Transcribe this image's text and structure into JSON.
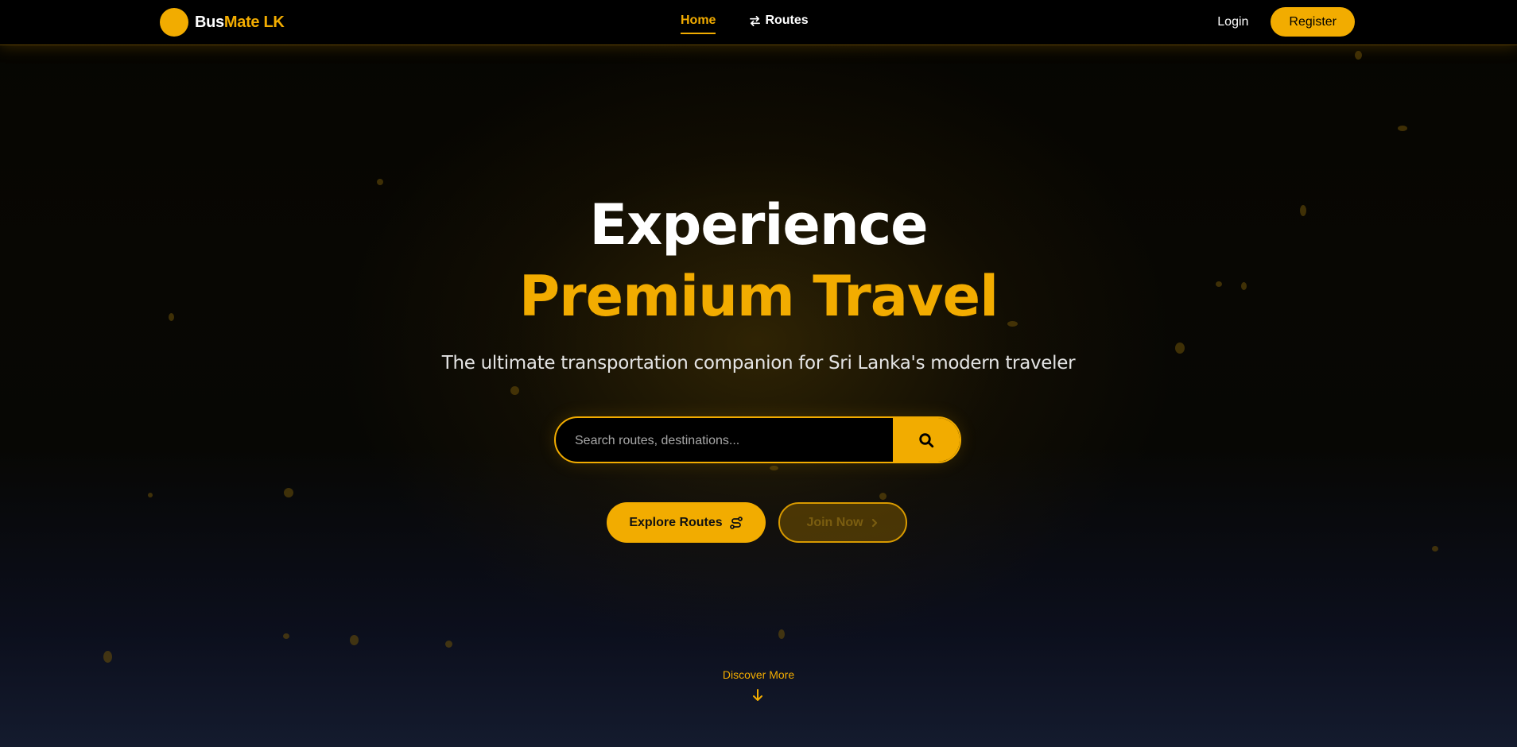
{
  "navbar": {
    "brand_part1": "Bus",
    "brand_part2": "Mate LK",
    "home_label": "Home",
    "routes_label": "Routes",
    "login_label": "Login",
    "register_label": "Register"
  },
  "hero": {
    "title_line1": "Experience",
    "title_line2": "Premium Travel",
    "subtitle": "The ultimate transportation companion for Sri Lanka's modern traveler"
  },
  "search": {
    "placeholder": "Search routes, destinations...",
    "value": "",
    "button_icon": "search-icon"
  },
  "buttons": {
    "explore_label": "Explore Routes",
    "explore_icon": "route-icon",
    "join_label": "Join Now",
    "join_icon": "chevron-right-icon"
  },
  "discover": {
    "label": "Discover More",
    "icon": "arrow-down-icon"
  },
  "colors": {
    "accent": "#f2ac00",
    "background": "#000000",
    "text": "#ffffff"
  }
}
